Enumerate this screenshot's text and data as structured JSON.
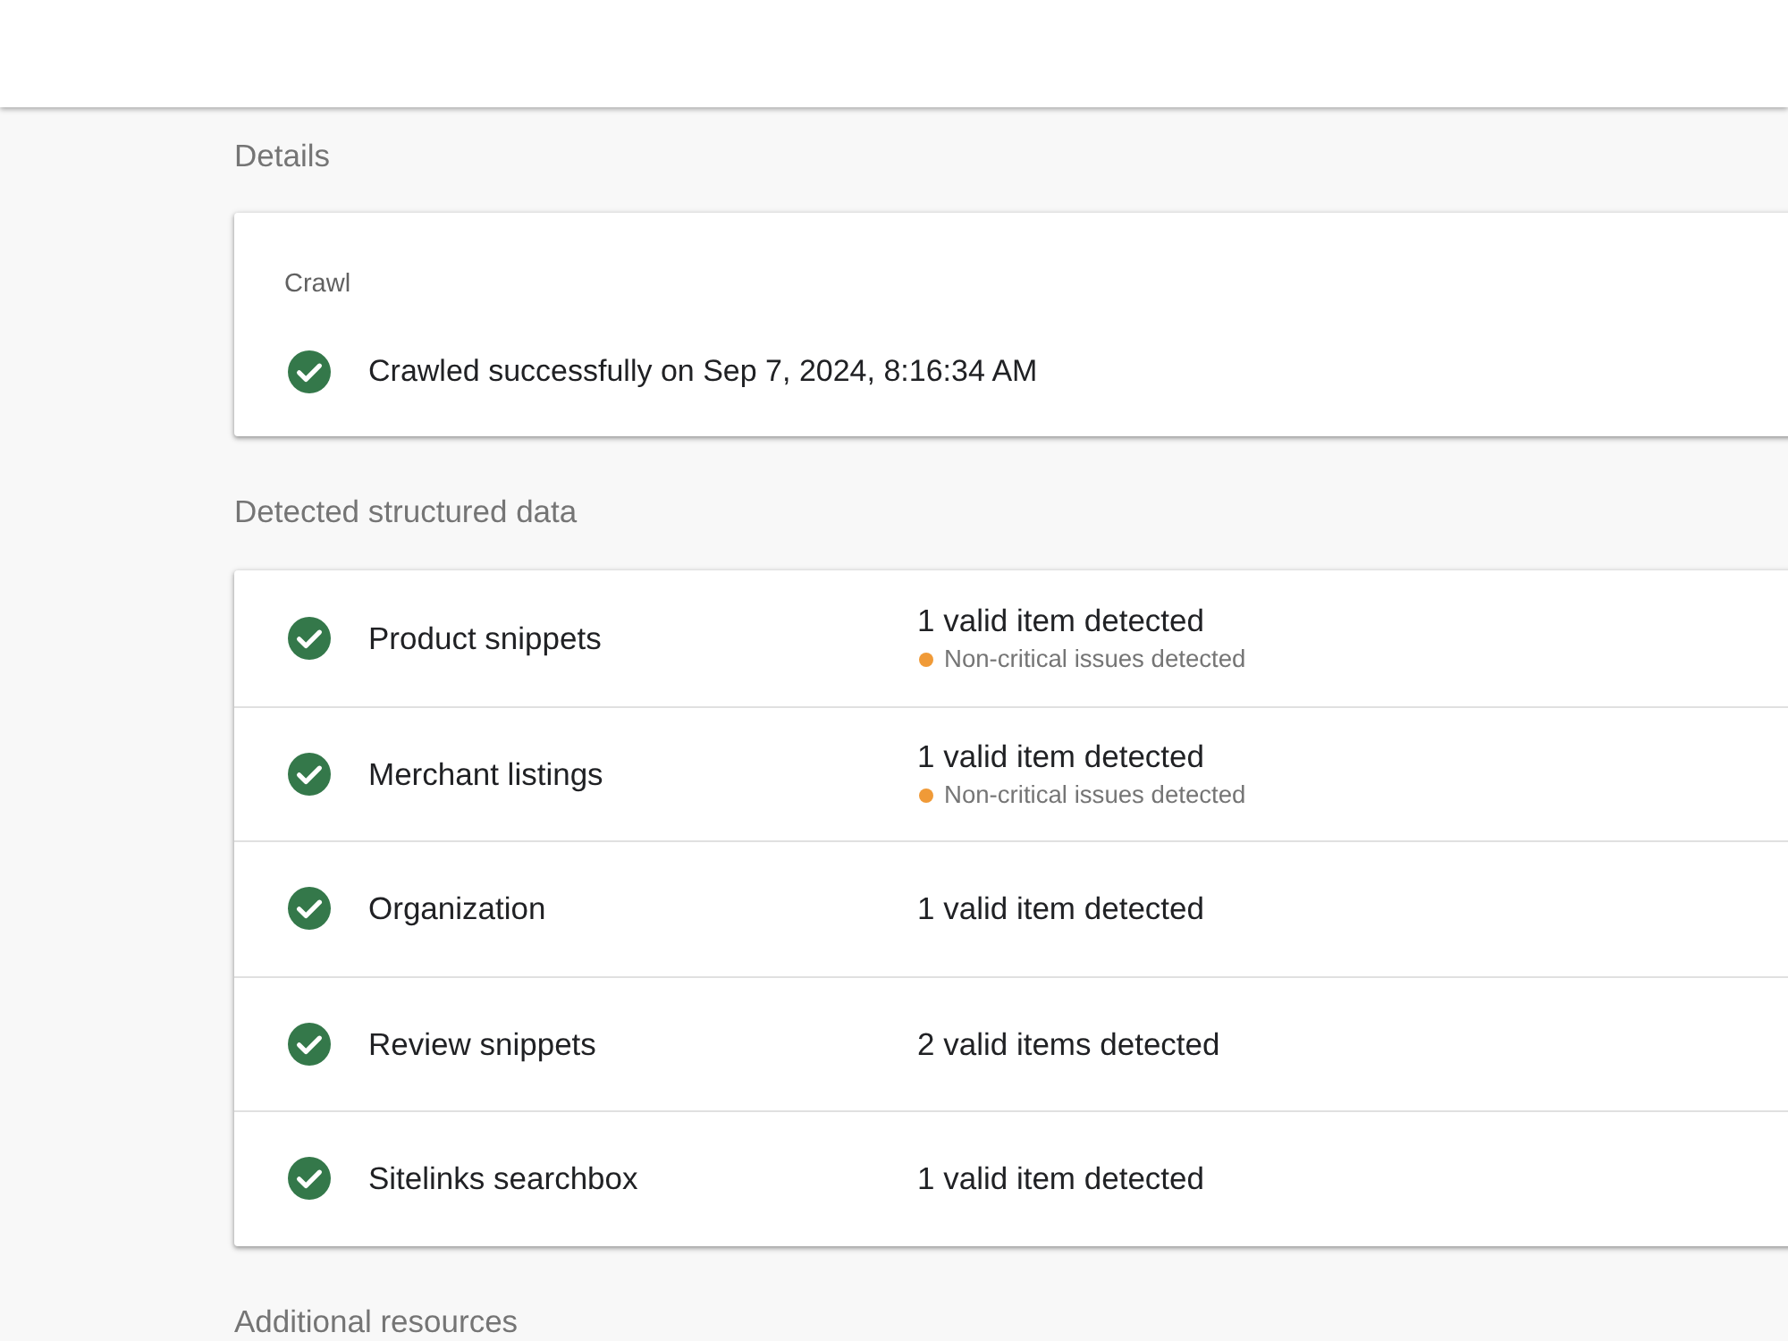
{
  "details": {
    "title": "Details",
    "crawl": {
      "label": "Crawl",
      "passed": true,
      "message": "Crawled successfully on Sep 7, 2024, 8:16:34 AM"
    }
  },
  "structured_data": {
    "title": "Detected structured data",
    "items": [
      {
        "name": "Product snippets",
        "passed": true,
        "result": "1 valid item detected",
        "warning": "Non-critical issues detected"
      },
      {
        "name": "Merchant listings",
        "passed": true,
        "result": "1 valid item detected",
        "warning": "Non-critical issues detected"
      },
      {
        "name": "Organization",
        "passed": true,
        "result": "1 valid item detected"
      },
      {
        "name": "Review snippets",
        "passed": true,
        "result": "2 valid items detected"
      },
      {
        "name": "Sitelinks searchbox",
        "passed": true,
        "result": "1 valid item detected"
      }
    ]
  },
  "additional_resources": {
    "title": "Additional resources"
  }
}
